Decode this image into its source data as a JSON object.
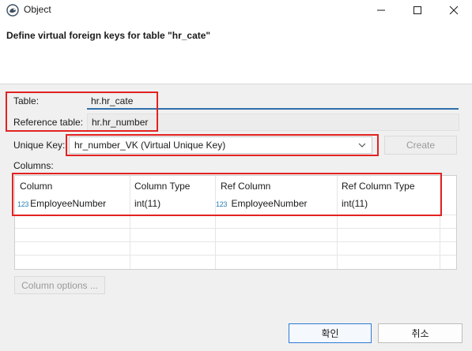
{
  "window": {
    "title": "Object",
    "minimize_icon": "minimize-icon",
    "maximize_icon": "maximize-icon",
    "close_icon": "close-icon"
  },
  "header": {
    "title": "Define virtual foreign keys for table \"hr_cate\""
  },
  "form": {
    "table_label": "Table:",
    "table_value": "hr.hr_cate",
    "ref_table_label": "Reference table:",
    "ref_table_value": "hr.hr_number",
    "unique_key_label": "Unique Key:",
    "unique_key_value": "hr_number_VK (Virtual Unique Key)",
    "create_button": "Create",
    "columns_label": "Columns:"
  },
  "columns_table": {
    "headers": [
      "Column",
      "Column Type",
      "Ref Column",
      "Ref Column Type"
    ],
    "rows": [
      {
        "column_icon": "123",
        "column": "EmployeeNumber",
        "column_type": "int(11)",
        "ref_column_icon": "123",
        "ref_column": "EmployeeNumber",
        "ref_column_type": "int(11)"
      }
    ]
  },
  "buttons": {
    "column_options": "Column options ...",
    "ok": "확인",
    "cancel": "취소"
  },
  "colors": {
    "highlight_border": "#e32221",
    "focus_blue": "#2f7bd6",
    "type_icon": "#2a7fb8"
  }
}
